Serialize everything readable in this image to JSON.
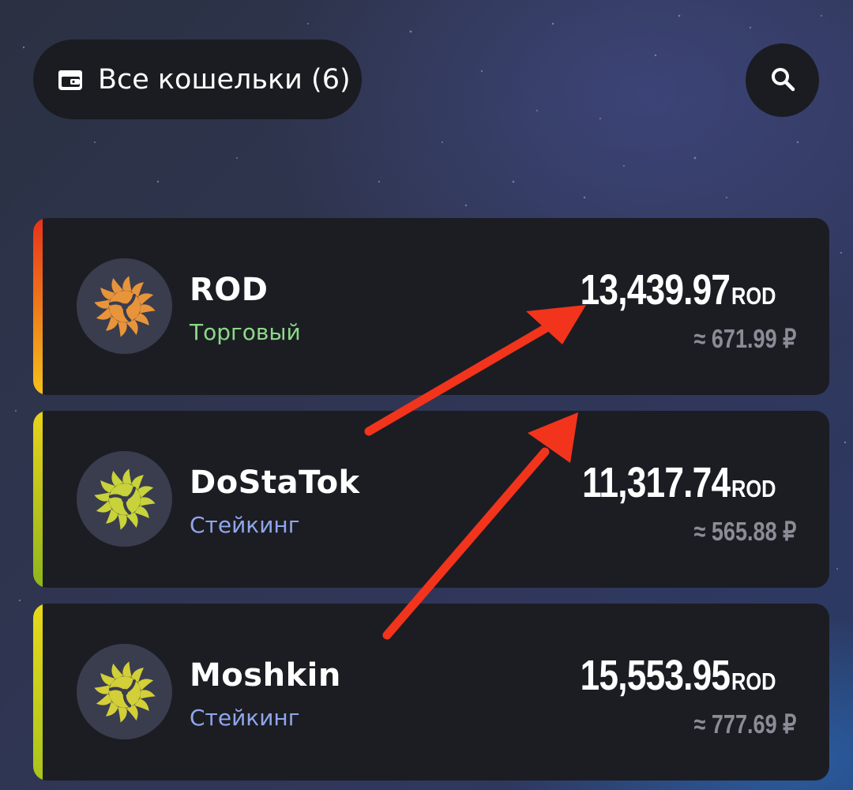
{
  "header": {
    "wallets_button_label": "Все кошельки (6)",
    "wallet_icon": "wallet-icon",
    "search_icon": "search-icon"
  },
  "wallets": [
    {
      "name": "ROD",
      "type": "Торговый",
      "type_color": "#8bd987",
      "amount": "13,439.97",
      "unit": "ROD",
      "fiat": "≈ 671.99 ₽",
      "stripe_colors": [
        "#e8321a",
        "#f5c21a"
      ],
      "logo_color": "#e8943a",
      "logo_icon": "sun-spiral-logo-icon"
    },
    {
      "name": "DoStaTok",
      "type": "Стейкинг",
      "type_color": "#8fa6ea",
      "amount": "11,317.74",
      "unit": "ROD",
      "fiat": "≈ 565.88 ₽",
      "stripe_colors": [
        "#e8d31a",
        "#8fb61c"
      ],
      "logo_color": "#c8d23a",
      "logo_icon": "sun-spiral-logo-icon"
    },
    {
      "name": "Moshkin",
      "type": "Стейкинг",
      "type_color": "#8fa6ea",
      "amount": "15,553.95",
      "unit": "ROD",
      "fiat": "≈ 777.69 ₽",
      "stripe_colors": [
        "#e8d81a",
        "#a9c41c"
      ],
      "logo_color": "#d2cf38",
      "logo_icon": "sun-spiral-logo-icon"
    }
  ],
  "annotation": {
    "arrow_color": "#f2341c",
    "arrow_icon": "red-arrow-annotation"
  }
}
